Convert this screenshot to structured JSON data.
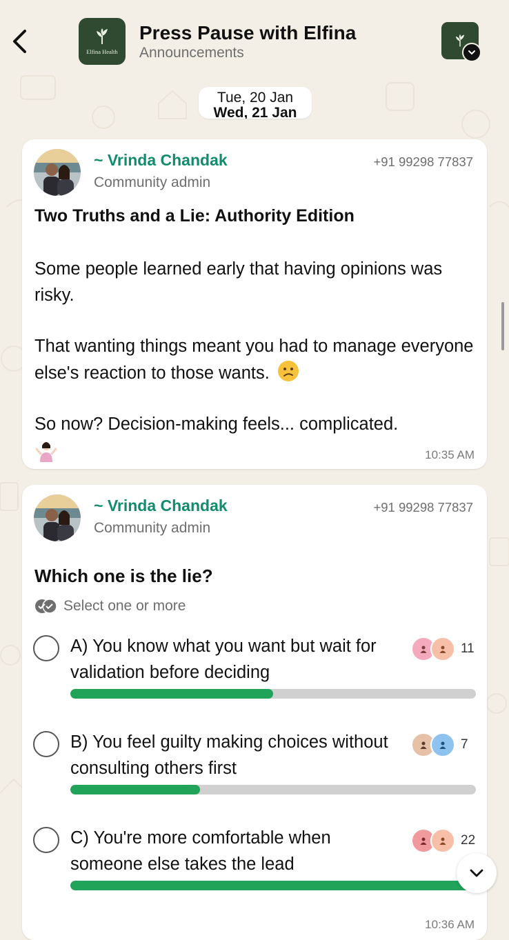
{
  "header": {
    "title": "Press Pause with Elfina",
    "subtitle": "Announcements",
    "logo_text": "Elfina Health"
  },
  "date_pill": {
    "current": "Tue, 20 Jan",
    "next": "Wed, 21 Jan"
  },
  "messages": [
    {
      "sender": "~ Vrinda Chandak",
      "role": "Community admin",
      "phone": "+91 99298 77837",
      "title": "Two Truths and a Lie: Authority Edition",
      "paragraphs": [
        "Some people learned early that having opinions was risky.",
        "That wanting things meant you had to manage everyone else's reaction to those wants.",
        "So now? Decision-making feels... complicated."
      ],
      "emojis": [
        "confused-face",
        "person-shrugging"
      ],
      "time": "10:35 AM"
    },
    {
      "sender": "~ Vrinda Chandak",
      "role": "Community admin",
      "phone": "+91 99298 77837",
      "poll": {
        "question": "Which one is the lie?",
        "hint": "Select one or more",
        "options": [
          {
            "label": "A) You know what you want but wait for validation before deciding",
            "votes": "11",
            "fill": 0.5
          },
          {
            "label": "B) You feel guilty making choices without consulting others first",
            "votes": "7",
            "fill": 0.32
          },
          {
            "label": "C) You're more comfortable when someone else takes the lead",
            "votes": "22",
            "fill": 1.0
          }
        ]
      },
      "time": "10:36 AM"
    }
  ],
  "colors": {
    "accent": "#128c6e",
    "bar": "#21a35a",
    "background": "#f3efe6"
  }
}
